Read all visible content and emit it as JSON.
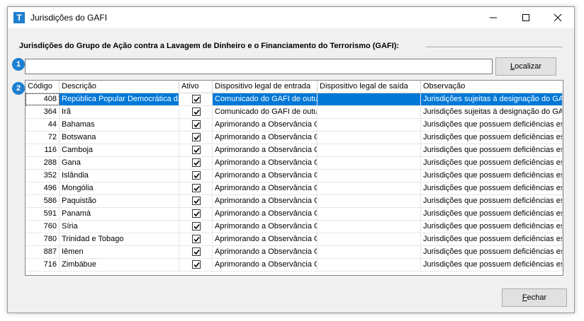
{
  "window": {
    "title": "Jurisdições do GAFI",
    "app_icon_letter": "T"
  },
  "group": {
    "title": "Jurisdições do Grupo de Ação contra a Lavagem de Dinheiro e o Financiamento do Terrorismo (GAFI):"
  },
  "badges": {
    "one": "1",
    "two": "2"
  },
  "search": {
    "value": "",
    "placeholder": ""
  },
  "buttons": {
    "localizar_first": "L",
    "localizar_rest": "ocalizar",
    "fechar_first": "F",
    "fechar_rest": "echar"
  },
  "table": {
    "columns": [
      "Código",
      "Descrição",
      "Ativo",
      "Dispositivo legal de entrada",
      "Dispositivo legal de saída",
      "Observação"
    ],
    "rows": [
      {
        "codigo": "408",
        "descricao": "República Popular Democrática da",
        "ativo": true,
        "entrada": "Comunicado do GAFI de outub",
        "saida": "",
        "observacao": "Jurisdições sujeitas à designação do GAF",
        "selected": true
      },
      {
        "codigo": "364",
        "descricao": "Irã",
        "ativo": true,
        "entrada": "Comunicado do GAFI de outub",
        "saida": "",
        "observacao": "Jurisdições sujeitas à designação do GAF"
      },
      {
        "codigo": "44",
        "descricao": "Bahamas",
        "ativo": true,
        "entrada": "Aprimorando a Observância G",
        "saida": "",
        "observacao": "Jurisdições que possuem deficiências estr"
      },
      {
        "codigo": "72",
        "descricao": "Botswana",
        "ativo": true,
        "entrada": "Aprimorando a Observância G",
        "saida": "",
        "observacao": "Jurisdições que possuem deficiências estr"
      },
      {
        "codigo": "116",
        "descricao": "Camboja",
        "ativo": true,
        "entrada": "Aprimorando a Observância G",
        "saida": "",
        "observacao": "Jurisdições que possuem deficiências estr"
      },
      {
        "codigo": "288",
        "descricao": "Gana",
        "ativo": true,
        "entrada": "Aprimorando a Observância G",
        "saida": "",
        "observacao": "Jurisdições que possuem deficiências estr"
      },
      {
        "codigo": "352",
        "descricao": "Islândia",
        "ativo": true,
        "entrada": "Aprimorando a Observância G",
        "saida": "",
        "observacao": "Jurisdições que possuem deficiências estr"
      },
      {
        "codigo": "496",
        "descricao": "Mongólia",
        "ativo": true,
        "entrada": "Aprimorando a Observância G",
        "saida": "",
        "observacao": "Jurisdições que possuem deficiências estr"
      },
      {
        "codigo": "586",
        "descricao": "Paquistão",
        "ativo": true,
        "entrada": "Aprimorando a Observância G",
        "saida": "",
        "observacao": "Jurisdições que possuem deficiências estr"
      },
      {
        "codigo": "591",
        "descricao": "Panamá",
        "ativo": true,
        "entrada": "Aprimorando a Observância G",
        "saida": "",
        "observacao": "Jurisdições que possuem deficiências estr"
      },
      {
        "codigo": "760",
        "descricao": "Síria",
        "ativo": true,
        "entrada": "Aprimorando a Observância G",
        "saida": "",
        "observacao": "Jurisdições que possuem deficiências estr"
      },
      {
        "codigo": "780",
        "descricao": "Trinidad e Tobago",
        "ativo": true,
        "entrada": "Aprimorando a Observância G",
        "saida": "",
        "observacao": "Jurisdições que possuem deficiências estr"
      },
      {
        "codigo": "887",
        "descricao": "Iêmen",
        "ativo": true,
        "entrada": "Aprimorando a Observância G",
        "saida": "",
        "observacao": "Jurisdições que possuem deficiências estr"
      },
      {
        "codigo": "716",
        "descricao": "Zimbábue",
        "ativo": true,
        "entrada": "Aprimorando a Observância G",
        "saida": "",
        "observacao": "Jurisdições que possuem deficiências estr"
      }
    ]
  },
  "colors": {
    "accent": "#1e7fd0",
    "selection": "#0078d7"
  }
}
